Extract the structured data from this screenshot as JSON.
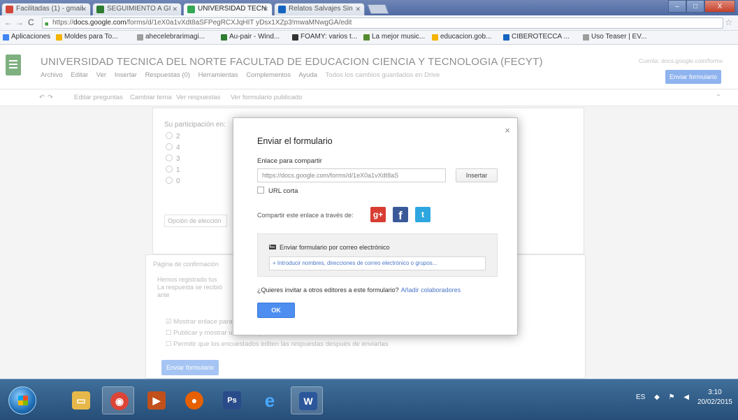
{
  "browser": {
    "tabs": [
      {
        "label": "Facilitadas (1) - gmail",
        "icon": "gmail-icon",
        "color": "#d44638"
      },
      {
        "label": "SEGUIMIENTO A GI",
        "icon": "drive-icon",
        "color": "#2e7d32"
      },
      {
        "label": "UNIVERSIDAD TECN",
        "icon": "forms-icon",
        "color": "#34a853"
      },
      {
        "label": "Relatos Salvajes Sin",
        "icon": "film-icon",
        "color": "#1565c0"
      }
    ],
    "url_prefix": "https://",
    "url_host": "docs.google.com",
    "url_path": "/forms/d/1eX0a1vXdt8aSFPegRCXJqHIT yDsx1XZp3!mwaMNwgGA/edit",
    "window_controls": {
      "minimize": "–",
      "maximize": "□",
      "close": "X"
    }
  },
  "bookmarks": [
    {
      "label": "Aplicaciones",
      "color": "#4285f4"
    },
    {
      "label": "Moldes para To...",
      "color": "#f4b400"
    },
    {
      "label": "ahecelebrarimagi...",
      "color": "#9e9e9e"
    },
    {
      "label": "Au-pair - Wind...",
      "color": "#2e7d32"
    },
    {
      "label": "FOAMY: varios t...",
      "color": "#333333"
    },
    {
      "label": "La mejor music...",
      "color": "#558b2f"
    },
    {
      "label": "educacion.gob...",
      "color": "#f4b400"
    },
    {
      "label": "CIBEROTECCA ...",
      "color": "#1565c0"
    },
    {
      "label": "Uso Teaser | EV...",
      "color": "#9e9e9e"
    }
  ],
  "forms_editor": {
    "title": "UNIVERSIDAD TECNICA DEL NORTE FACULTAD DE EDUCACION CIENCIA Y TECNOLOGIA (FECYT)",
    "menu": [
      "Archivo",
      "Editar",
      "Ver",
      "Insertar",
      "Respuestas (0)",
      "Herramientas",
      "Complementos",
      "Ayuda"
    ],
    "save_hint": "Todos los cambios guardados en Drive",
    "header_right": "Cuenta: docs.google.com/forms",
    "send_button": "Enviar formulario",
    "toolbar": [
      "Editar preguntas",
      "Cambiar tema",
      "Ver respuestas",
      "Ver formulario publicado"
    ],
    "question_label": "Su participación en:",
    "options": [
      "2",
      "4",
      "3",
      "1",
      "0"
    ],
    "question_select": "Opción de elección",
    "section_header": "Página de confirmación",
    "section_lines": [
      "Hemos registrado tus",
      "La respuesta se recibió",
      "ante"
    ],
    "section_checks": [
      "Mostrar enlace para enviar otra respuesta",
      "Publicar y mostrar un enlace público a los resultados",
      "Permitir que los encuestados editen las respuestas después de enviarlas"
    ],
    "section_button": "Enviar formulario"
  },
  "dialog": {
    "title": "Enviar el formulario",
    "close_glyph": "×",
    "link_label": "Enlace para compartir",
    "link_value": "https://docs.google.com/forms/d/1eX0a1vXdt8aS",
    "embed_button": "Insertar",
    "short_url_label": "URL corta",
    "share_label": "Compartir este enlace a través de:",
    "social": {
      "gplus": "g+",
      "facebook": "f",
      "twitter": "t"
    },
    "email_header": "Enviar formulario por correo electrónico",
    "email_placeholder": "+ Introducir nombres, direcciones de correo electrónico o grupos...",
    "invite_text": "¿Quieres invitar a otros editores a este formulario?",
    "invite_link": "Añadir colaboradores",
    "ok_button": "OK"
  },
  "taskbar": {
    "apps": [
      {
        "name": "file-explorer-icon",
        "glyph": "▭",
        "color": "#e6b84a"
      },
      {
        "name": "chrome-icon",
        "glyph": "◉",
        "color": "#db4437"
      },
      {
        "name": "media-player-icon",
        "glyph": "▶",
        "color": "#c1501b"
      },
      {
        "name": "firefox-icon",
        "glyph": "●",
        "color": "#e66000"
      },
      {
        "name": "photoshop-icon",
        "glyph": "Ps",
        "color": "#2a4b8a"
      },
      {
        "name": "internet-explorer-icon",
        "glyph": "e",
        "color": "#1e88e5"
      },
      {
        "name": "word-icon",
        "glyph": "W",
        "color": "#2b579a"
      }
    ],
    "language": "ES",
    "time": "3:10",
    "date": "20/02/2015"
  }
}
